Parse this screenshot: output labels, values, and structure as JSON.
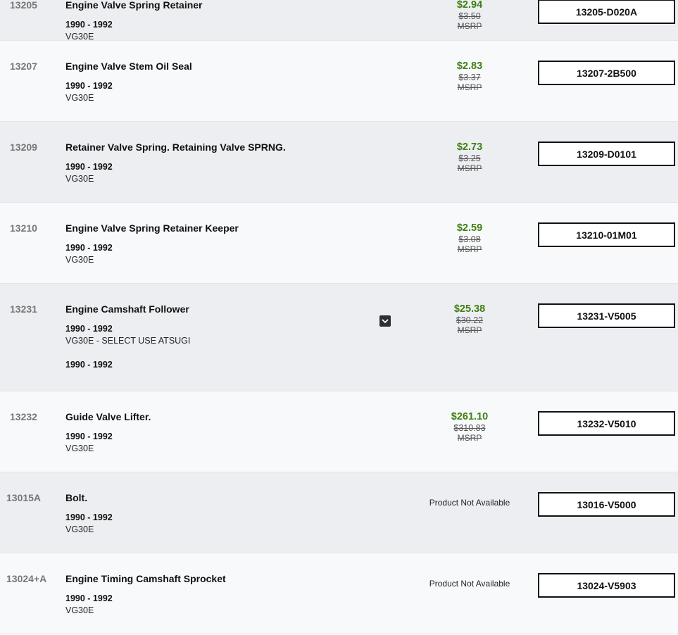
{
  "parts": [
    {
      "ref": "13205",
      "name": "Engine Valve Spring Retainer",
      "years": "1990 - 1992",
      "engine": "VG30E",
      "price": "$2.94",
      "was": "$3.50",
      "msrp": "MSRP",
      "part_number": "13205-D020A"
    },
    {
      "ref": "13207",
      "name": "Engine Valve Stem Oil Seal",
      "years": "1990 - 1992",
      "engine": "VG30E",
      "price": "$2.83",
      "was": "$3.37",
      "msrp": "MSRP",
      "part_number": "13207-2B500"
    },
    {
      "ref": "13209",
      "name": "Retainer Valve Spring. Retaining Valve SPRNG.",
      "years": "1990 - 1992",
      "engine": "VG30E",
      "price": "$2.73",
      "was": "$3.25",
      "msrp": "MSRP",
      "part_number": "13209-D0101"
    },
    {
      "ref": "13210",
      "name": "Engine Valve Spring Retainer Keeper",
      "years": "1990 - 1992",
      "engine": "VG30E",
      "price": "$2.59",
      "was": "$3.08",
      "msrp": "MSRP",
      "part_number": "13210-01M01"
    },
    {
      "ref": "13231",
      "name": "Engine Camshaft Follower",
      "years": "1990 - 1992",
      "engine": "VG30E - SELECT USE ATSUGI",
      "years2": "1990 - 1992",
      "price": "$25.38",
      "was": "$30.22",
      "msrp": "MSRP",
      "part_number": "13231-V5005",
      "expand_icon": "chevron-down-icon"
    },
    {
      "ref": "13232",
      "name": "Guide Valve Lifter.",
      "years": "1990 - 1992",
      "engine": "VG30E",
      "price": "$261.10",
      "was": "$310.83",
      "msrp": "MSRP",
      "part_number": "13232-V5010"
    },
    {
      "ref": "13015A",
      "name": "Bolt.",
      "years": "1990 - 1992",
      "engine": "VG30E",
      "availability": "Product Not Available",
      "part_number": "13016-V5000"
    },
    {
      "ref": "13024+A",
      "name": "Engine Timing Camshaft Sprocket",
      "years": "1990 - 1992",
      "engine": "VG30E",
      "availability": "Product Not Available",
      "part_number": "13024-V5903"
    }
  ],
  "colors": {
    "price_green": "#3f7f12",
    "row_shade": "#eceef1",
    "row_light": "#f8f9fa"
  }
}
